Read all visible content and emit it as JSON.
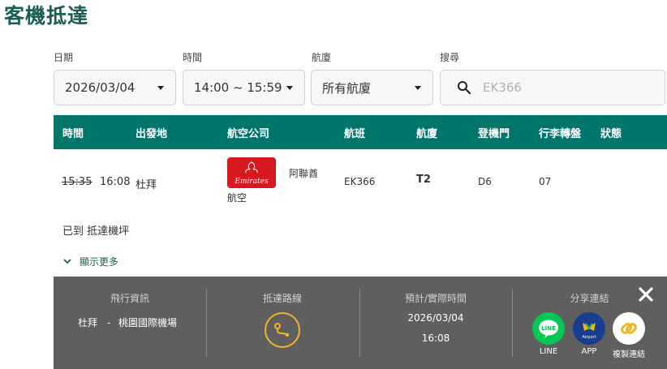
{
  "page": {
    "title": "客機抵達"
  },
  "filters": {
    "date_label": "日期",
    "date_value": "2026/03/04",
    "time_label": "時間",
    "time_value": "14:00 ~ 15:59",
    "terminal_label": "航廈",
    "terminal_value": "所有航廈",
    "search_label": "搜尋",
    "search_placeholder": "EK366"
  },
  "table": {
    "headers": [
      "時間",
      "出發地",
      "航空公司",
      "航班",
      "航廈",
      "登機門",
      "行李轉盤",
      "狀態"
    ],
    "rows": [
      {
        "scheduled_time": "15:35",
        "actual_time": "16:08",
        "origin": "杜拜",
        "airline_line1": "阿聯酋",
        "airline_line2": "航空",
        "airline_logo_text": "Emirates",
        "flight": "EK366",
        "terminal": "T2",
        "gate": "D6",
        "carousel": "07",
        "status": "",
        "status_detail": "已到 抵達機坪",
        "show_more": "顯示更多"
      }
    ]
  },
  "detail_panel": {
    "flight_info_title": "飛行資訊",
    "route_from": "杜拜",
    "route_sep": "-",
    "route_to": "桃園國際機場",
    "route_title": "抵達路線",
    "time_title": "預計/實際時間",
    "time_date": "2026/03/04",
    "time_value": "16:08",
    "share_title": "分享連結",
    "share_line": "LINE",
    "share_app": "APP",
    "share_copy": "複製連結",
    "app_icon_text": "Airport"
  },
  "colors": {
    "brand_green": "#00766b",
    "title_green": "#1b5e55",
    "panel_bg": "#5f5f5f",
    "line_green": "#06c755",
    "emirates_red": "#d71921",
    "route_gold": "#f0b429"
  },
  "icons": [
    "chevron-down-icon",
    "search-icon",
    "route-icon",
    "close-icon",
    "line-icon",
    "app-icon",
    "link-icon"
  ]
}
